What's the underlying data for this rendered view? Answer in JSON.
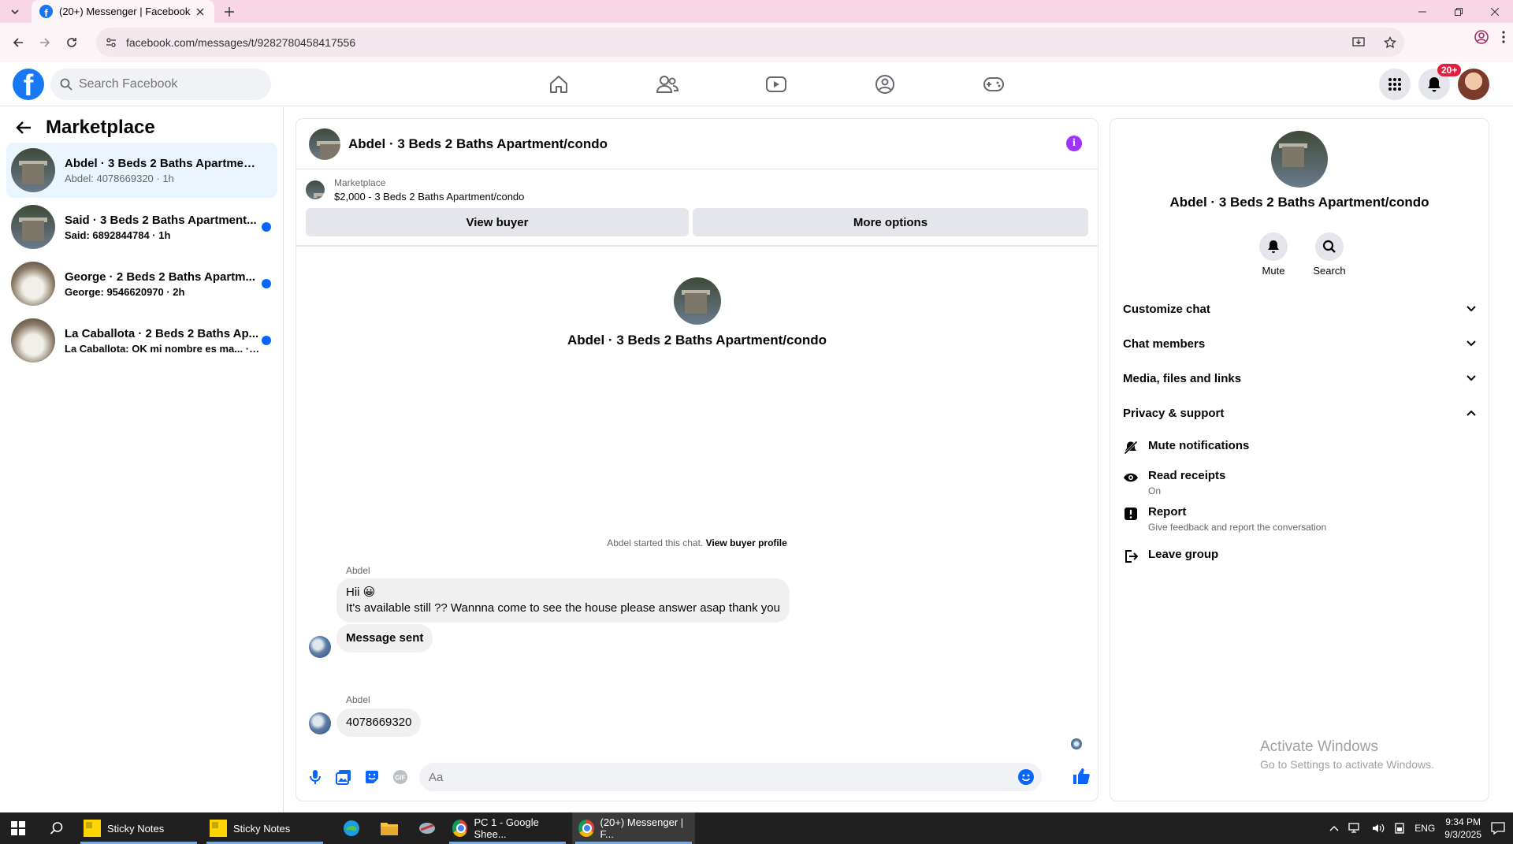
{
  "browser": {
    "tab_title": "(20+) Messenger | Facebook",
    "url": "facebook.com/messages/t/9282780458417556"
  },
  "fb": {
    "search_placeholder": "Search Facebook",
    "notif_badge": "20+",
    "brand_color": "#1877f2"
  },
  "left": {
    "title": "Marketplace",
    "conversations": [
      {
        "title": "Abdel · 3 Beds 2 Baths Apartment/...",
        "preview": "Abdel: 4078669320 · 1h",
        "unread": false,
        "active": true
      },
      {
        "title": "Said · 3 Beds 2 Baths Apartment...",
        "preview": "Said: 6892844784 · 1h",
        "unread": true,
        "active": false
      },
      {
        "title": "George · 2 Beds 2 Baths Apartm...",
        "preview": "George: 9546620970 · 2h",
        "unread": true,
        "active": false
      },
      {
        "title": "La Caballota · 2 Beds 2 Baths Ap...",
        "preview": "La Caballota: OK mi nombre es ma... · 2h",
        "unread": true,
        "active": false
      }
    ]
  },
  "chat": {
    "header_name": "Abdel · 3 Beds 2 Baths Apartment/condo",
    "listing_source": "Marketplace",
    "listing_title": "$2,000 - 3 Beds 2 Baths Apartment/condo",
    "view_buyer": "View buyer",
    "more_options": "More options",
    "intro_name": "Abdel · 3 Beds 2 Baths Apartment/condo",
    "started_text": "Abdel started this chat.",
    "view_buyer_profile": "View buyer profile",
    "sender1": "Abdel",
    "msg1_line1": "Hii 😀",
    "msg1_line2": "It's available still ?? Wannna come to see the house please answer asap thank you",
    "msg2": "Message sent",
    "sender2": "Abdel",
    "msg3": "4078669320",
    "input_placeholder": "Aa"
  },
  "info": {
    "name": "Abdel · 3 Beds 2 Baths Apartment/condo",
    "mute": "Mute",
    "search": "Search",
    "sections": [
      "Customize chat",
      "Chat members",
      "Media, files and links",
      "Privacy & support"
    ],
    "mute_notifications": "Mute notifications",
    "read_receipts": "Read receipts",
    "read_receipts_state": "On",
    "report": "Report",
    "report_sub": "Give feedback and report the conversation",
    "leave_group": "Leave group"
  },
  "watermark": {
    "line1": "Activate Windows",
    "line2": "Go to Settings to activate Windows."
  },
  "taskbar": {
    "apps": [
      "Sticky Notes",
      "Sticky Notes",
      "PC 1 - Google Shee...",
      "(20+) Messenger | F..."
    ],
    "lang": "ENG",
    "time": "9:34 PM",
    "date": "9/3/2025"
  }
}
